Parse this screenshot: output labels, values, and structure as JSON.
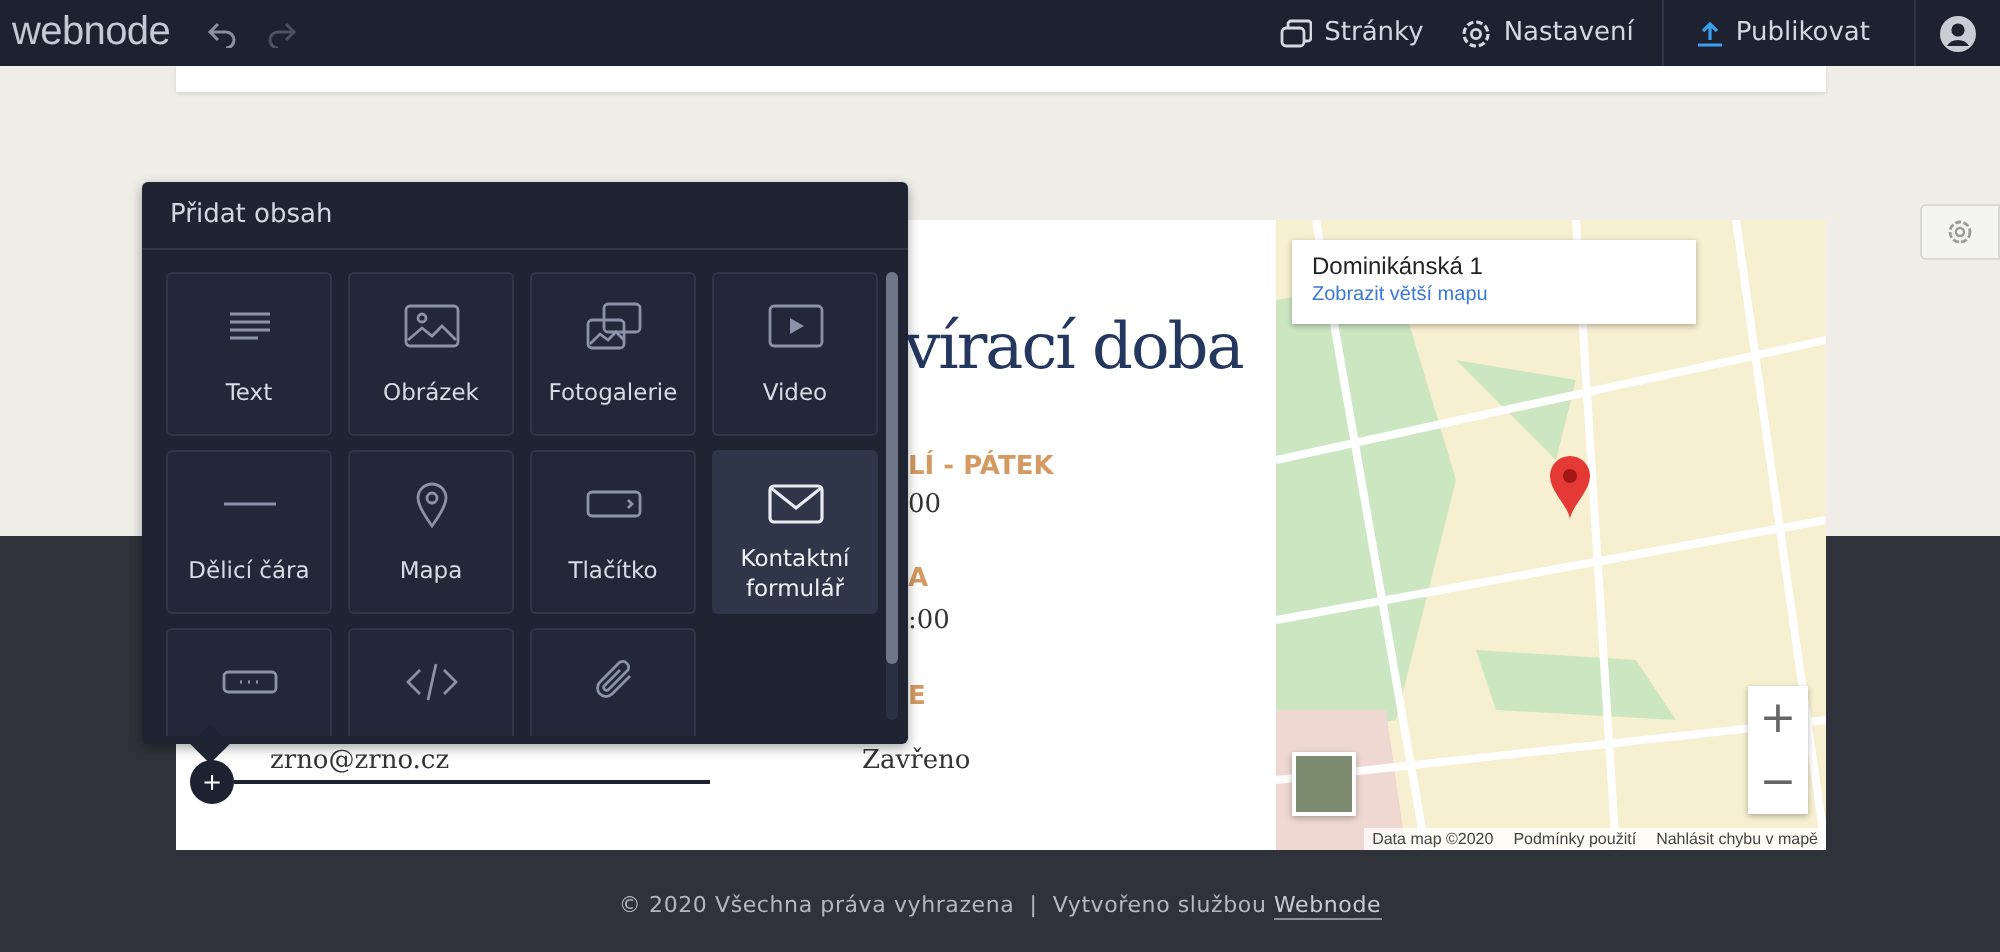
{
  "topbar": {
    "logo": "webnode",
    "actions": [
      {
        "kind": "pages",
        "label": "Stránky"
      },
      {
        "kind": "settings",
        "label": "Nastavení"
      }
    ],
    "publish": "Publikovat"
  },
  "section": {
    "heading": "vírací doba",
    "hours": [
      {
        "day": "LÍ - PÁTEK",
        "time": "00"
      },
      {
        "day": "A",
        "time": ":00"
      },
      {
        "day": "E",
        "time": "Zavřeno"
      }
    ],
    "email": "zrno@zrno.cz",
    "add_handle": "+"
  },
  "map": {
    "place": "Dominikánská 1",
    "link": "Zobrazit větší mapu",
    "zoom_in": "+",
    "zoom_out": "−",
    "attribution": [
      "Data map ©2020",
      "Podmínky použití",
      "Nahlásit chybu v mapě"
    ]
  },
  "panel": {
    "title": "Přidat obsah",
    "tiles": [
      {
        "kind": "text",
        "label": "Text",
        "selected": false
      },
      {
        "kind": "image",
        "label": "Obrázek",
        "selected": false
      },
      {
        "kind": "gallery",
        "label": "Fotogalerie",
        "selected": false
      },
      {
        "kind": "video",
        "label": "Video",
        "selected": false
      },
      {
        "kind": "divider",
        "label": "Dělicí čára",
        "selected": false
      },
      {
        "kind": "map",
        "label": "Mapa",
        "selected": false
      },
      {
        "kind": "button",
        "label": "Tlačítko",
        "selected": false
      },
      {
        "kind": "mail",
        "label": "Kontaktní formulář",
        "selected": true
      },
      {
        "kind": "custom",
        "selected": false
      },
      {
        "kind": "code",
        "selected": false
      },
      {
        "kind": "file",
        "selected": false
      }
    ]
  },
  "footer": {
    "text": "© 2020 Všechna práva vyhrazena  |  Vytvořeno službou ",
    "link": "Webnode"
  }
}
